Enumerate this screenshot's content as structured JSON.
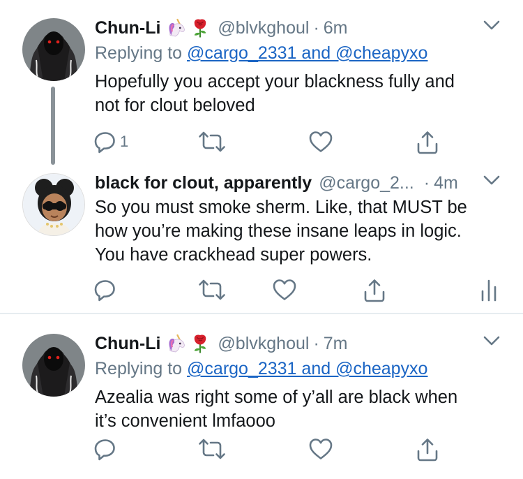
{
  "tweets": [
    {
      "name": "Chun-Li",
      "emoji": [
        "unicorn-emoji",
        "rose-emoji"
      ],
      "handle": "@blvkghoul",
      "time": "6m",
      "replying_prefix": "Replying to",
      "replying_to": "@cargo_2331 and @cheapyxo",
      "text_line1": "Hopefully you accept your blackness fully and",
      "text_line2": "not for clout beloved",
      "reply_count": "1"
    },
    {
      "name": "black for clout, apparently",
      "handle": "@cargo_2...",
      "time": "4m",
      "text_line1": "So you must smoke sherm. Like, that MUST be",
      "text_line2": "how you’re making these insane leaps in logic.",
      "text_line3": "You have crackhead super powers."
    },
    {
      "name": "Chun-Li",
      "emoji": [
        "unicorn-emoji",
        "rose-emoji"
      ],
      "handle": "@blvkghoul",
      "time": "7m",
      "replying_prefix": "Replying to",
      "replying_to": "@cargo_2331 and @cheapyxo",
      "text_line1": "Azealia was right some of y’all are black when",
      "text_line2": "it’s convenient lmfaooo"
    }
  ],
  "separator": "·",
  "colors": {
    "text": "#14171a",
    "secondary": "#657786",
    "link": "#1b65c4",
    "icon": "#657786",
    "thread_line": "#8a9298"
  }
}
